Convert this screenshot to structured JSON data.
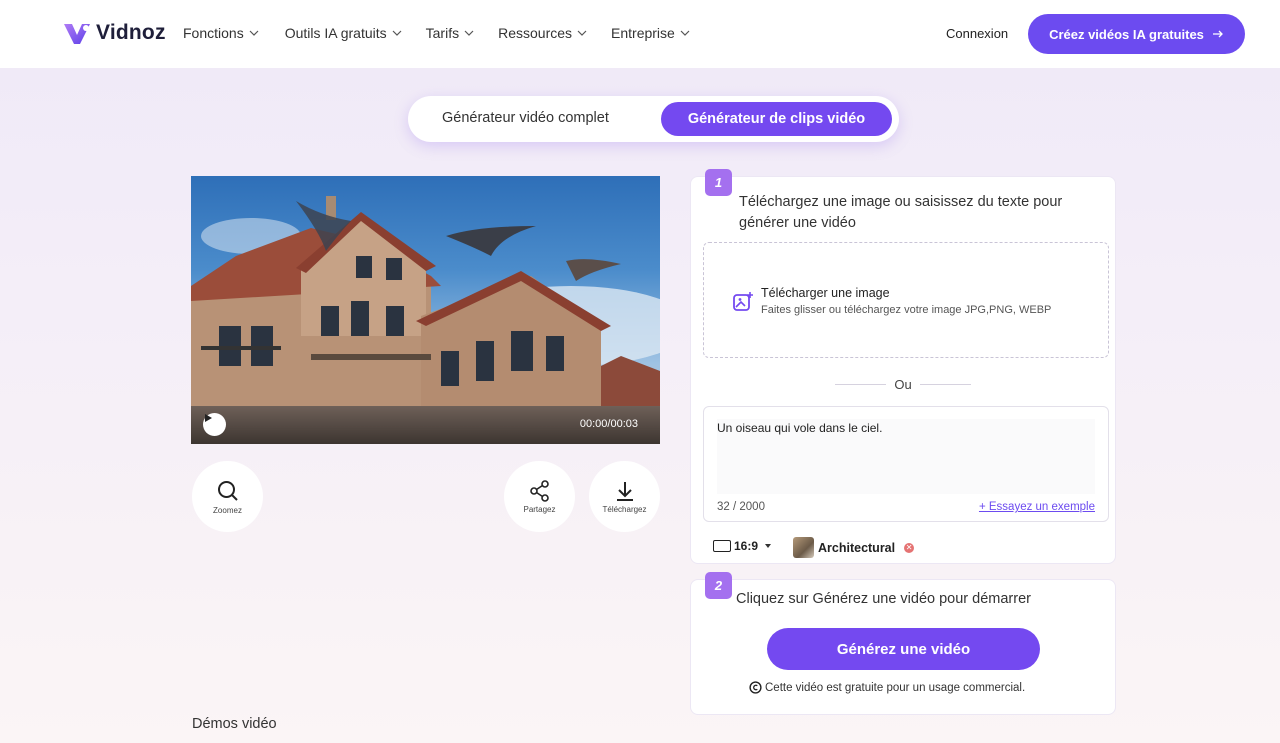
{
  "nav": {
    "logo_text": "Vidnoz",
    "items": [
      {
        "label": "Fonctions"
      },
      {
        "label": "Outils IA gratuits"
      },
      {
        "label": "Tarifs"
      },
      {
        "label": "Ressources"
      },
      {
        "label": "Entreprise"
      }
    ],
    "login_label": "Connexion",
    "cta_label": "Créez vidéos IA gratuites"
  },
  "toggle": {
    "option_full": "Générateur vidéo complet",
    "option_clips": "Générateur de clips vidéo",
    "active": "option_clips"
  },
  "player": {
    "time": "00:00/00:03",
    "progress": 0
  },
  "actions": {
    "zoom_label": "Zoomez",
    "share_label": "Partagez",
    "download_label": "Téléchargez"
  },
  "step1": {
    "badge": "1",
    "title": "Téléchargez une image ou saisissez du texte pour générer une vidéo",
    "upload_title": "Télécharger une image",
    "upload_subtitle": "Faites glisser ou téléchargez votre image JPG,PNG, WEBP",
    "or_label": "Ou",
    "prompt_value": "Un oiseau qui vole dans le ciel.",
    "char_count": "32 / 2000",
    "example_link": "+ Essayez un exemple",
    "ratio": "16:9",
    "style_name": "Architectural"
  },
  "step2": {
    "badge": "2",
    "title": "Cliquez sur Générez une vidéo pour démarrer",
    "generate_label": "Générez une vidéo",
    "note": "Cette vidéo est gratuite pour un usage commercial."
  },
  "demos_heading": "Démos vidéo",
  "colors": {
    "accent": "#7449f0",
    "badge": "#a470ef",
    "link": "#6c4bf0"
  }
}
